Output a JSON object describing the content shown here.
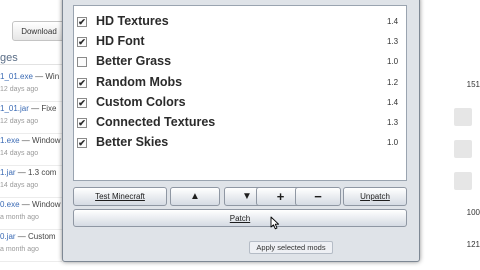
{
  "background_page": {
    "download_label": "Download",
    "section_heading": "ges",
    "files": [
      {
        "name": "1_01.exe",
        "desc": " — Win",
        "date": "12 days ago"
      },
      {
        "name": "1_01.jar",
        "desc": " — Fixe",
        "date": "12 days ago"
      },
      {
        "name": "1.exe",
        "desc": " — Window",
        "date": "14 days ago"
      },
      {
        "name": "1.jar",
        "desc": " — 1.3 com",
        "date": "14 days ago"
      },
      {
        "name": "0.exe",
        "desc": " — Window",
        "date": "a month ago"
      },
      {
        "name": "0.jar",
        "desc": " — Custom",
        "date": "a month ago"
      }
    ],
    "right_counts": [
      "151",
      "",
      "",
      "",
      "100",
      "121"
    ]
  },
  "dialog": {
    "mods": [
      {
        "label": "HD Textures",
        "version": "1.4",
        "checked": true
      },
      {
        "label": "HD Font",
        "version": "1.3",
        "checked": true
      },
      {
        "label": "Better Grass",
        "version": "1.0",
        "checked": false
      },
      {
        "label": "Random Mobs",
        "version": "1.2",
        "checked": true
      },
      {
        "label": "Custom Colors",
        "version": "1.4",
        "checked": true
      },
      {
        "label": "Connected Textures",
        "version": "1.3",
        "checked": true
      },
      {
        "label": "Better Skies",
        "version": "1.0",
        "checked": true
      }
    ],
    "buttons": {
      "test_minecraft": "Test Minecraft",
      "move_up": "▲",
      "move_down": "▼",
      "add": "+",
      "remove": "−",
      "unpatch": "Unpatch",
      "patch": "Patch"
    },
    "status_text": "Apply selected mods"
  },
  "icons": {
    "checkbox_checked": "✔",
    "cursor": "mouse-pointer"
  },
  "colors": {
    "window_bg": "#dfe3e8",
    "link_blue": "#3a6ab4"
  }
}
